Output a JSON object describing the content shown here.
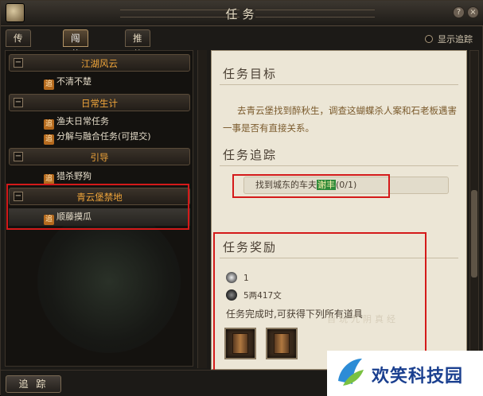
{
  "window": {
    "title": "任务"
  },
  "tabs": [
    {
      "label": "传记小说"
    },
    {
      "label": "闯荡江湖",
      "active": true
    },
    {
      "label": "推荐任务"
    }
  ],
  "show_track": {
    "label": "显示追踪",
    "checked": false
  },
  "quest_list": {
    "groups": [
      {
        "label": "江湖风云",
        "toggle": "−",
        "items": [
          {
            "label": "不清不楚"
          }
        ]
      },
      {
        "label": "日常生计",
        "toggle": "−",
        "items": [
          {
            "label": "渔夫日常任务"
          },
          {
            "label": "分解与融合任务(可提交)"
          }
        ]
      },
      {
        "label": "引导",
        "toggle": "−",
        "items": [
          {
            "label": "猎杀野狗"
          }
        ]
      },
      {
        "label": "青云堡禁地",
        "toggle": "−",
        "items": [
          {
            "label": "顺藤摸瓜",
            "selected": true
          }
        ]
      }
    ],
    "track_badge": "追"
  },
  "detail": {
    "goal_heading": "任务目标",
    "goal_text": "去青云堡找到醉秋生，调查这蝴蝶杀人案和石老板遇害一事是否有直接关系。",
    "track_heading": "任务追踪",
    "track_prefix": "找到城东的车夫",
    "track_name": "谢丰",
    "track_progress": "(0/1)",
    "reward_heading": "任务奖励",
    "reward_exp": "1",
    "reward_money": "5两417文",
    "reward_items_label": "任务完成时,可获得下列所有道具",
    "reward_item_count": 2
  },
  "watermark": "自玩九阴真经",
  "footer": {
    "trace_button": "追 踪"
  },
  "brand": {
    "text": "欢笑科技园"
  },
  "colors": {
    "group_label": "#f0a53a",
    "highlight_border": "#d41a1a",
    "track_name_bg": "#2f8a3a"
  }
}
